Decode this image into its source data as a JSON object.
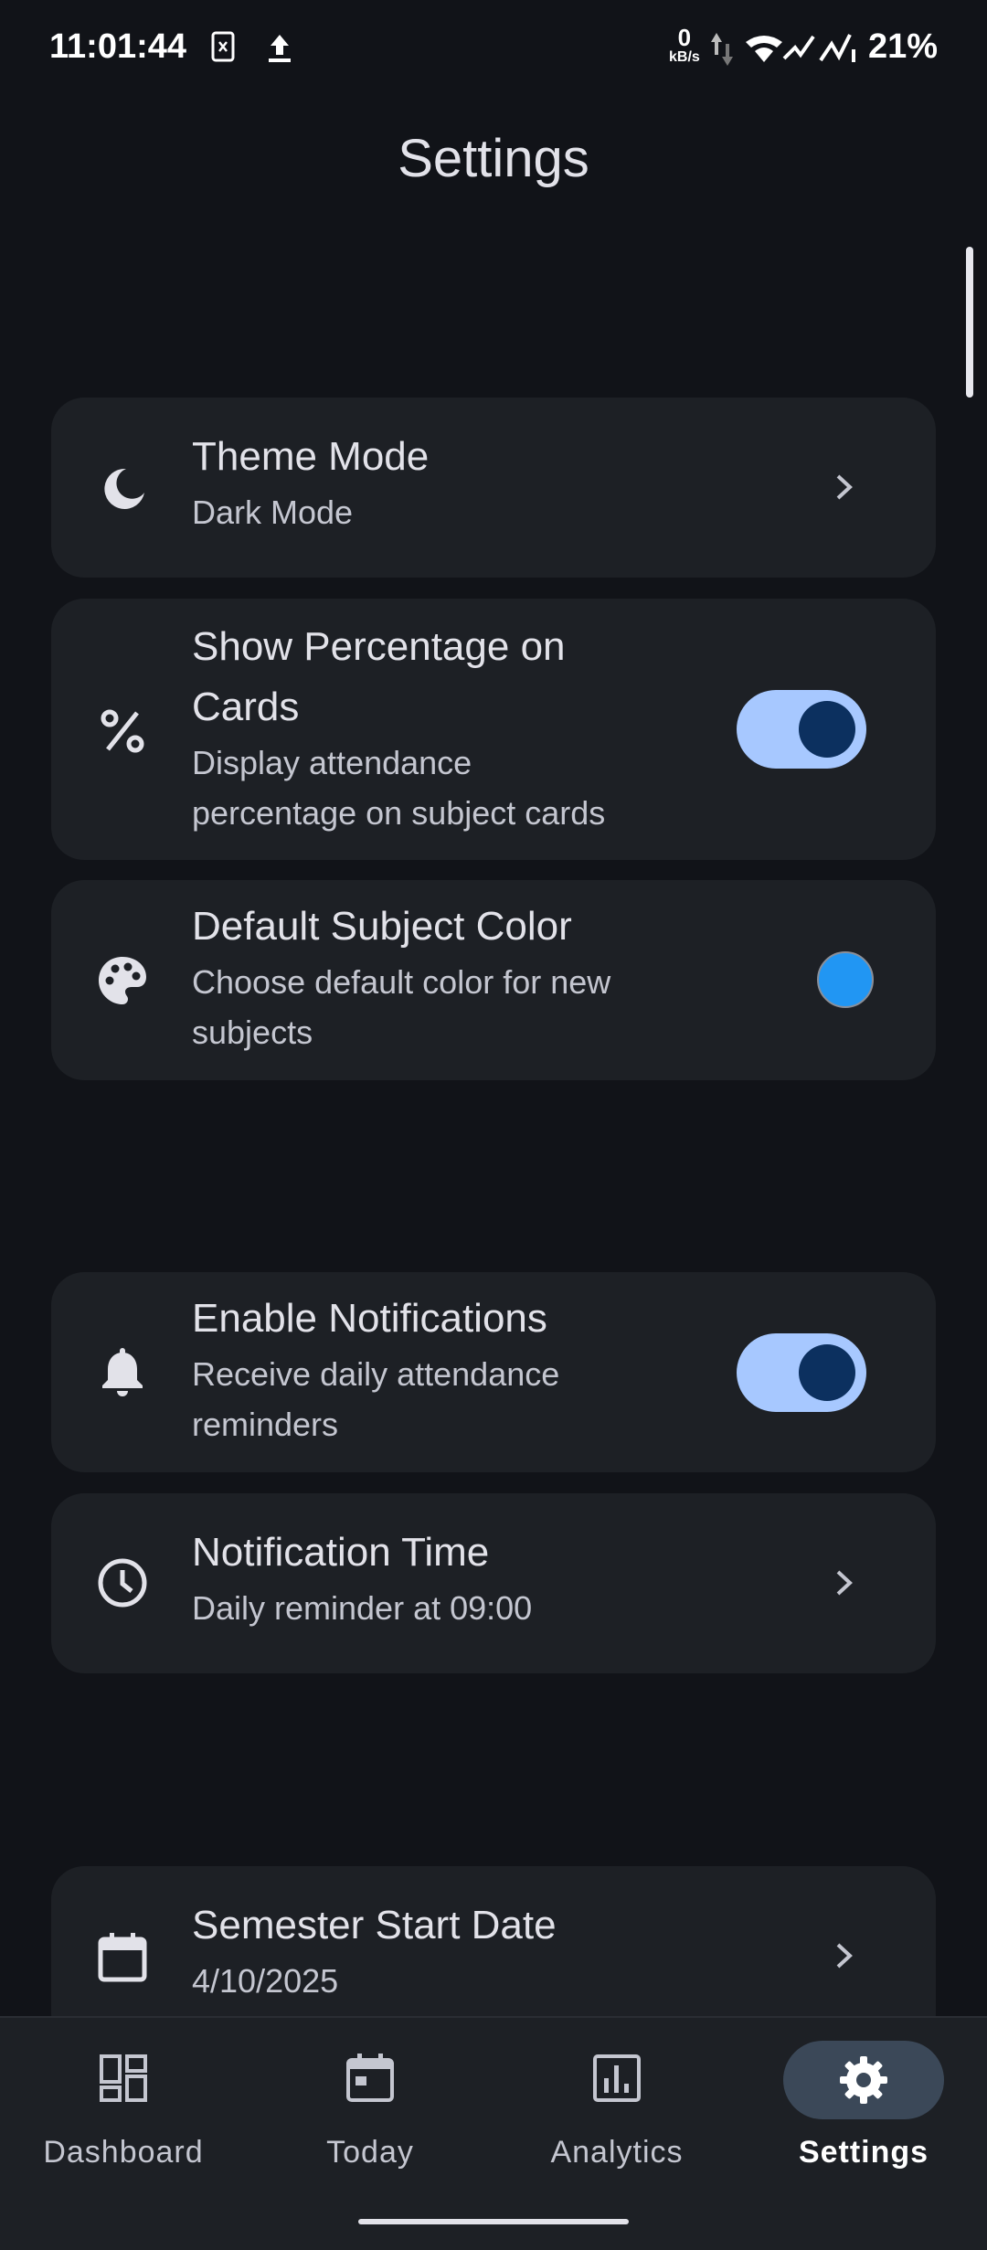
{
  "status_bar": {
    "time": "11:01:44",
    "net_speed_value": "0",
    "net_speed_unit": "kB/s",
    "battery": "21%"
  },
  "page": {
    "title": "Settings"
  },
  "settings": {
    "theme_mode": {
      "title": "Theme Mode",
      "subtitle": "Dark Mode",
      "icon": "moon-icon"
    },
    "show_percentage": {
      "title": "Show Percentage on Cards",
      "subtitle": "Display attendance percentage on subject cards",
      "icon": "percent-icon",
      "enabled": true
    },
    "default_color": {
      "title": "Default Subject Color",
      "subtitle": "Choose default color for new subjects",
      "icon": "palette-icon",
      "color": "#2196F3"
    },
    "notifications": {
      "title": "Enable Notifications",
      "subtitle": "Receive daily attendance reminders",
      "icon": "bell-icon",
      "enabled": true
    },
    "notification_time": {
      "title": "Notification Time",
      "subtitle": "Daily reminder at 09:00",
      "icon": "clock-icon"
    },
    "semester_start": {
      "title": "Semester Start Date",
      "subtitle": "4/10/2025",
      "icon": "calendar-icon"
    }
  },
  "nav": {
    "items": [
      {
        "label": "Dashboard",
        "icon": "dashboard-icon"
      },
      {
        "label": "Today",
        "icon": "calendar-icon"
      },
      {
        "label": "Analytics",
        "icon": "analytics-icon"
      },
      {
        "label": "Settings",
        "icon": "gear-icon",
        "active": true
      }
    ]
  },
  "colors": {
    "background": "#111318",
    "card": "#1D2025",
    "switch_track": "#A7C8FF",
    "switch_thumb": "#0C305F",
    "active_pill": "#3B4858"
  }
}
